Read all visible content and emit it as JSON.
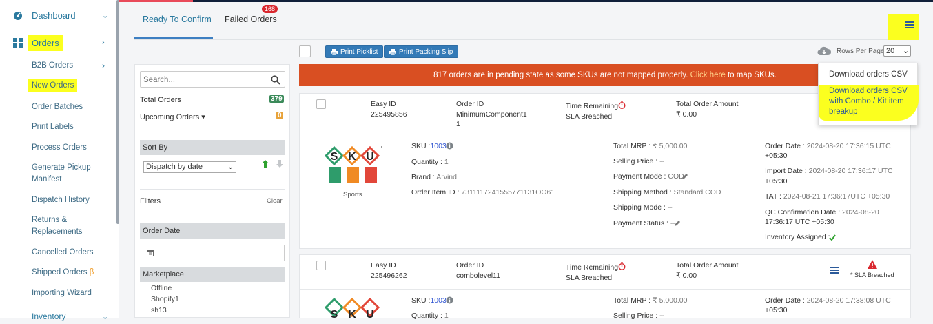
{
  "sidebar": {
    "dashboard": "Dashboard",
    "orders": "Orders",
    "items": [
      "B2B Orders",
      "New Orders",
      "Order Batches",
      "Print Labels",
      "Process Orders",
      "Generate Pickup",
      "Manifest",
      "Dispatch History",
      "Returns &",
      "Replacements",
      "Cancelled Orders",
      "Shipped Orders",
      "Importing Wizard"
    ],
    "beta": "β",
    "inventory": "Inventory"
  },
  "tabs": {
    "ready": "Ready To Confirm",
    "failed": "Failed Orders",
    "failed_count": "168"
  },
  "toolbar": {
    "print_picklist": "Print Picklist",
    "print_packing_slip": "Print Packing Slip",
    "rows_per_page_label": "Rows Per Page",
    "rows_per_page_value": "20"
  },
  "dropdown": {
    "download_csv": "Download orders CSV",
    "download_combo": "Download orders CSV with Combo / Kit item breakup"
  },
  "filters": {
    "search_placeholder": "Search...",
    "total_orders_label": "Total Orders",
    "total_orders_count": "379",
    "upcoming_orders_label": "Upcoming Orders ▾",
    "upcoming_orders_count": "0",
    "sort_by": "Sort By",
    "sort_value": "Dispatch by date",
    "filters_label": "Filters",
    "clear": "Clear",
    "order_date": "Order Date",
    "marketplace": "Marketplace",
    "marketplaces": [
      "Offline",
      "Shopify1",
      "sh13"
    ]
  },
  "banner": {
    "text": "817 orders are in pending state as some SKUs are not mapped properly.",
    "link": "Click here",
    "suffix": "to map SKUs."
  },
  "orders": [
    {
      "easy_id_label": "Easy ID",
      "easy_id": "225495856",
      "order_id_label": "Order ID",
      "order_id_l1": "MinimumComponent1",
      "order_id_l2": "1",
      "time_remaining_label": "Time Remaining",
      "sla": "SLA Breached",
      "total_amount_label": "Total Order Amount",
      "total_amount": "₹ 0.00",
      "logo_text": "Sports",
      "sku_label": "SKU :",
      "sku": "1003",
      "qty_label": "Quantity :",
      "qty": "1",
      "brand_label": "Brand :",
      "brand": "Arvind",
      "item_id_label": "Order Item ID :",
      "item_id": "7311117241555771131OO61",
      "mrp_label": "Total MRP :",
      "mrp": "₹ 5,000.00",
      "selling_label": "Selling Price :",
      "selling": "--",
      "paymode_label": "Payment Mode :",
      "paymode": "COD",
      "shipmethod_label": "Shipping Method :",
      "shipmethod": "Standard COD",
      "shipmode_label": "Shipping Mode :",
      "shipmode": "--",
      "paystatus_label": "Payment Status :",
      "paystatus": "--",
      "order_date_label": "Order Date :",
      "order_date_l1": "2024-08-20 17:36:15 UTC",
      "order_date_l2": "+05:30",
      "import_date_label": "Import Date :",
      "import_date_l1": "2024-08-20 17:36:17 UTC",
      "import_date_l2": "+05:30",
      "tat_label": "TAT :",
      "tat": "2024-08-21 17:36:17UTC +05:30",
      "qc_label": "QC Confirmation Date :",
      "qc_l1": "2024-08-20",
      "qc_l2": "17:36:17 UTC +05:30",
      "inv_label": "Inventory Assigned :"
    },
    {
      "easy_id_label": "Easy ID",
      "easy_id": "225496262",
      "order_id_label": "Order ID",
      "order_id_l1": "combolevel11",
      "time_remaining_label": "Time Remaining",
      "sla": "SLA Breached",
      "total_amount_label": "Total Order Amount",
      "total_amount": "₹ 0.00",
      "sla_right": "* SLA Breached",
      "sku_label": "SKU :",
      "sku": "1003",
      "qty_label": "Quantity :",
      "qty": "1",
      "mrp_label": "Total MRP :",
      "mrp": "₹ 5,000.00",
      "selling_label": "Selling Price :",
      "selling": "--",
      "order_date_label": "Order Date :",
      "order_date_l1": "2024-08-20 17:38:08 UTC",
      "order_date_l2": "+05:30"
    }
  ],
  "colors": {
    "accent": "#2b7a9f",
    "highlight": "#fbff1f",
    "banner": "#d94f22",
    "primary_btn": "#337ab7",
    "sla_red": "#d9282f"
  }
}
